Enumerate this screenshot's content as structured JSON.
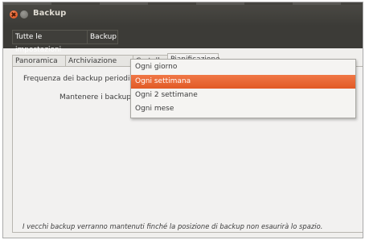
{
  "window": {
    "title": "Backup"
  },
  "breadcrumbs": [
    "Tutte le impostazioni",
    "Backup"
  ],
  "tabs": [
    "Panoramica",
    "Archiviazione",
    "Cartelle",
    "Pianificazione"
  ],
  "settings": {
    "frequency_label": "Frequenza dei backup periodici",
    "keep_label": "Mantenere i backup",
    "footer_note": "I vecchi backup verranno mantenuti finché la posizione di backup non esaurirà lo spazio."
  },
  "dropdown": {
    "options": [
      "Ogni giorno",
      "Ogni settimana",
      "Ogni 2 settimane",
      "Ogni mese"
    ],
    "selected": "Ogni settimana"
  },
  "colors": {
    "accent": "#e9622c",
    "titlebar": "#3c3b37"
  }
}
